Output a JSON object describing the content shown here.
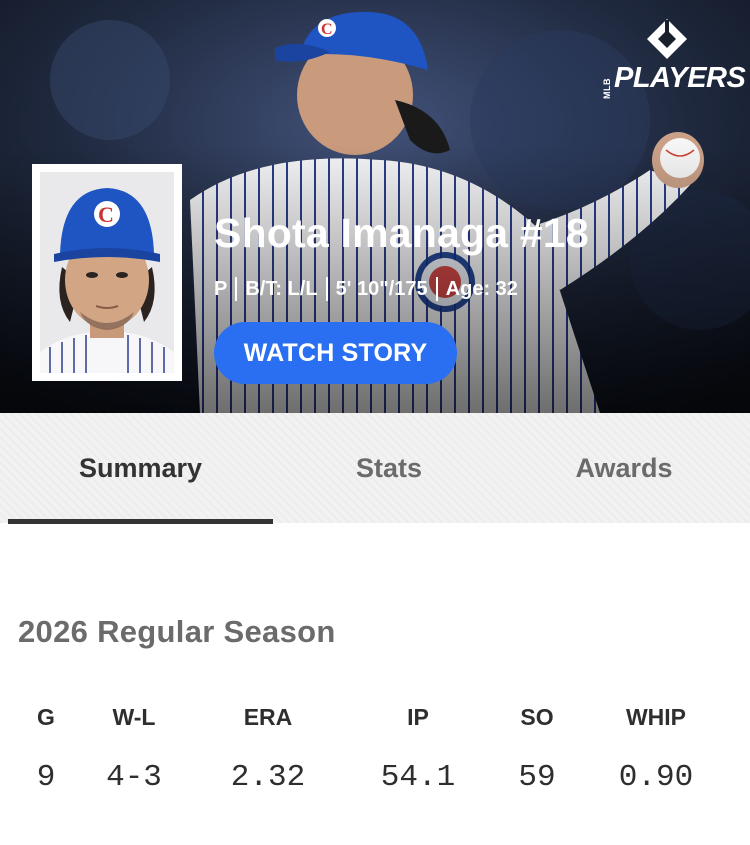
{
  "brand": {
    "logo_small": "MLB",
    "logo_text": "PLAYERS"
  },
  "player": {
    "name": "Shota Imanaga #18",
    "position": "P",
    "bats_throws": "B/T: L/L",
    "height_weight": "5' 10\"/175",
    "age": "Age: 32"
  },
  "hero": {
    "watch_story": "WATCH STORY"
  },
  "tabs": [
    {
      "label": "Summary",
      "active": true
    },
    {
      "label": "Stats",
      "active": false
    },
    {
      "label": "Awards",
      "active": false
    }
  ],
  "season": {
    "title": "2026 Regular Season",
    "stats": [
      {
        "label": "G",
        "value": "9"
      },
      {
        "label": "W-L",
        "value": "4-3"
      },
      {
        "label": "ERA",
        "value": "2.32"
      },
      {
        "label": "IP",
        "value": "54.1"
      },
      {
        "label": "SO",
        "value": "59"
      },
      {
        "label": "WHIP",
        "value": "0.90"
      }
    ]
  },
  "colors": {
    "accent": "#2a6ff2",
    "cubs_blue": "#0e3386",
    "cubs_red": "#cc3433"
  }
}
